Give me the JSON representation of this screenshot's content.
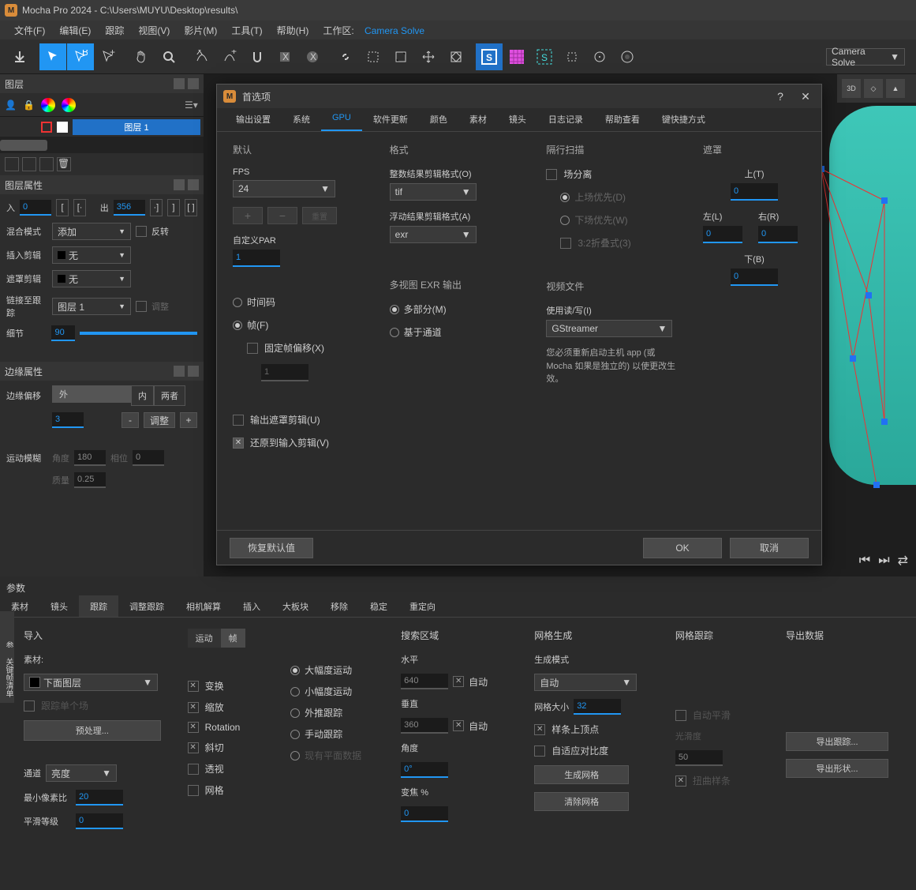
{
  "title": "Mocha Pro 2024 - C:\\Users\\MUYU\\Desktop\\results\\",
  "menu": {
    "file": "文件(F)",
    "edit": "编辑(E)",
    "track": "跟踪",
    "view": "视图(V)",
    "clip": "影片(M)",
    "tool": "工具(T)",
    "help": "帮助(H)",
    "wslabel": "工作区:",
    "wsval": "Camera Solve"
  },
  "toolbar": {
    "camera_solve": "Camera Solve",
    "3d": "3D"
  },
  "panels": {
    "layers": "图层",
    "layer_props": "图层属性",
    "edge_props": "边缘属性"
  },
  "layer": {
    "name": "图层 1"
  },
  "props": {
    "in": "入",
    "out": "出",
    "in_val": "0",
    "out_val": "356",
    "blend": "混合模式",
    "blend_val": "添加",
    "reverse": "反转",
    "insert_clip": "插入剪辑",
    "none": "无",
    "matte_clip": "遮罩剪辑",
    "link_track": "链接至跟踪",
    "link_val": "图层 1",
    "adjust": "调整",
    "detail": "细节",
    "detail_val": "90"
  },
  "edge": {
    "offset": "边缘偏移",
    "outer": "外",
    "inner": "内",
    "both": "两者",
    "offset_val": "3",
    "adjust": "调整",
    "motion_blur": "运动模糊",
    "angle": "角度",
    "angle_val": "180",
    "phase": "相位",
    "phase_val": "0",
    "quality": "质量",
    "quality_val": "0.25"
  },
  "params_label": "参数",
  "vtabs": {
    "params": "参数",
    "dopesheet": "关键帧清单"
  },
  "ptabs": {
    "clip": "素材",
    "lens": "镜头",
    "track": "跟踪",
    "adjust": "调整跟踪",
    "camera": "相机解算",
    "insert": "插入",
    "mega": "大板块",
    "remove": "移除",
    "stabilize": "稳定",
    "reorient": "重定向"
  },
  "track_panel": {
    "import": "导入",
    "clip": "素材:",
    "below": "下面图层",
    "track_single": "跟踪单个场",
    "preprocess": "预处理...",
    "channel": "通道",
    "luma": "亮度",
    "min_pixel": "最小像素比",
    "min_pixel_val": "20",
    "smooth": "平滑等级",
    "smooth_val": "0",
    "motion": "运动",
    "frame": "帧",
    "transform": "变换",
    "scale": "缩放",
    "rotation": "Rotation",
    "shear": "斜切",
    "perspective": "透视",
    "grid": "网格",
    "large_mv": "大幅度运动",
    "small_mv": "小幅度运动",
    "push_track": "外推跟踪",
    "manual_track": "手动跟踪",
    "existing_planar": "现有平面数据",
    "search": "搜索区域",
    "horiz": "水平",
    "horiz_val": "640",
    "vert": "垂直",
    "vert_val": "360",
    "auto": "自动",
    "angle": "角度",
    "angle_val": "0°",
    "zoom": "变焦 %",
    "zoom_val": "0",
    "mesh_gen": "网格生成",
    "gen_mode": "生成模式",
    "auto_mode": "自动",
    "mesh_size": "网格大小",
    "mesh_size_val": "32",
    "sample_vertex": "样条上顶点",
    "adaptive": "自适应对比度",
    "gen_mesh": "生成网格",
    "clear_mesh": "清除网格",
    "mesh_track": "网格跟踪",
    "auto_smooth": "自动平滑",
    "smoothness": "光滑度",
    "smoothness_val": "50",
    "warp_spline": "扭曲样条",
    "export": "导出数据",
    "export_track": "导出跟踪...",
    "export_shape": "导出形状..."
  },
  "dialog": {
    "title": "首选项",
    "tabs": {
      "output": "输出设置",
      "system": "系统",
      "gpu": "GPU",
      "update": "软件更新",
      "color": "颜色",
      "clip": "素材",
      "lens": "镜头",
      "log": "日志记录",
      "helpview": "帮助查看",
      "shortcuts": "键快捷方式"
    },
    "default": "默认",
    "fps": "FPS",
    "fps_val": "24",
    "custom_par": "自定义PAR",
    "par_val": "1",
    "timecode": "时间码",
    "frame": "帧(F)",
    "fixed_offset": "固定帧偏移(X)",
    "offset_val": "1",
    "output_matte": "输出遮罩剪辑(U)",
    "revert_input": "还原到输入剪辑(V)",
    "format": "格式",
    "int_result": "整数结果剪辑格式(O)",
    "int_val": "tif",
    "float_result": "浮动结果剪辑格式(A)",
    "float_val": "exr",
    "multiview": "多视图 EXR 输出",
    "multipart": "多部分(M)",
    "channel_based": "基于通道",
    "interlace": "隔行扫描",
    "field_sep": "场分离",
    "upper": "上场优先(D)",
    "lower": "下场优先(W)",
    "pulldown": "3:2折叠式(3)",
    "video_file": "视频文件",
    "use_rw": "使用读/写(I)",
    "gstreamer": "GStreamer",
    "restart_note": "您必须重新启动主机 app (或 Mocha 如果是独立的) 以使更改生效。",
    "matte": "遮罩",
    "top": "上(T)",
    "left": "左(L)",
    "right": "右(R)",
    "bottom": "下(B)",
    "zero": "0",
    "reset": "恢复默认值",
    "ok": "OK",
    "cancel": "取消"
  }
}
